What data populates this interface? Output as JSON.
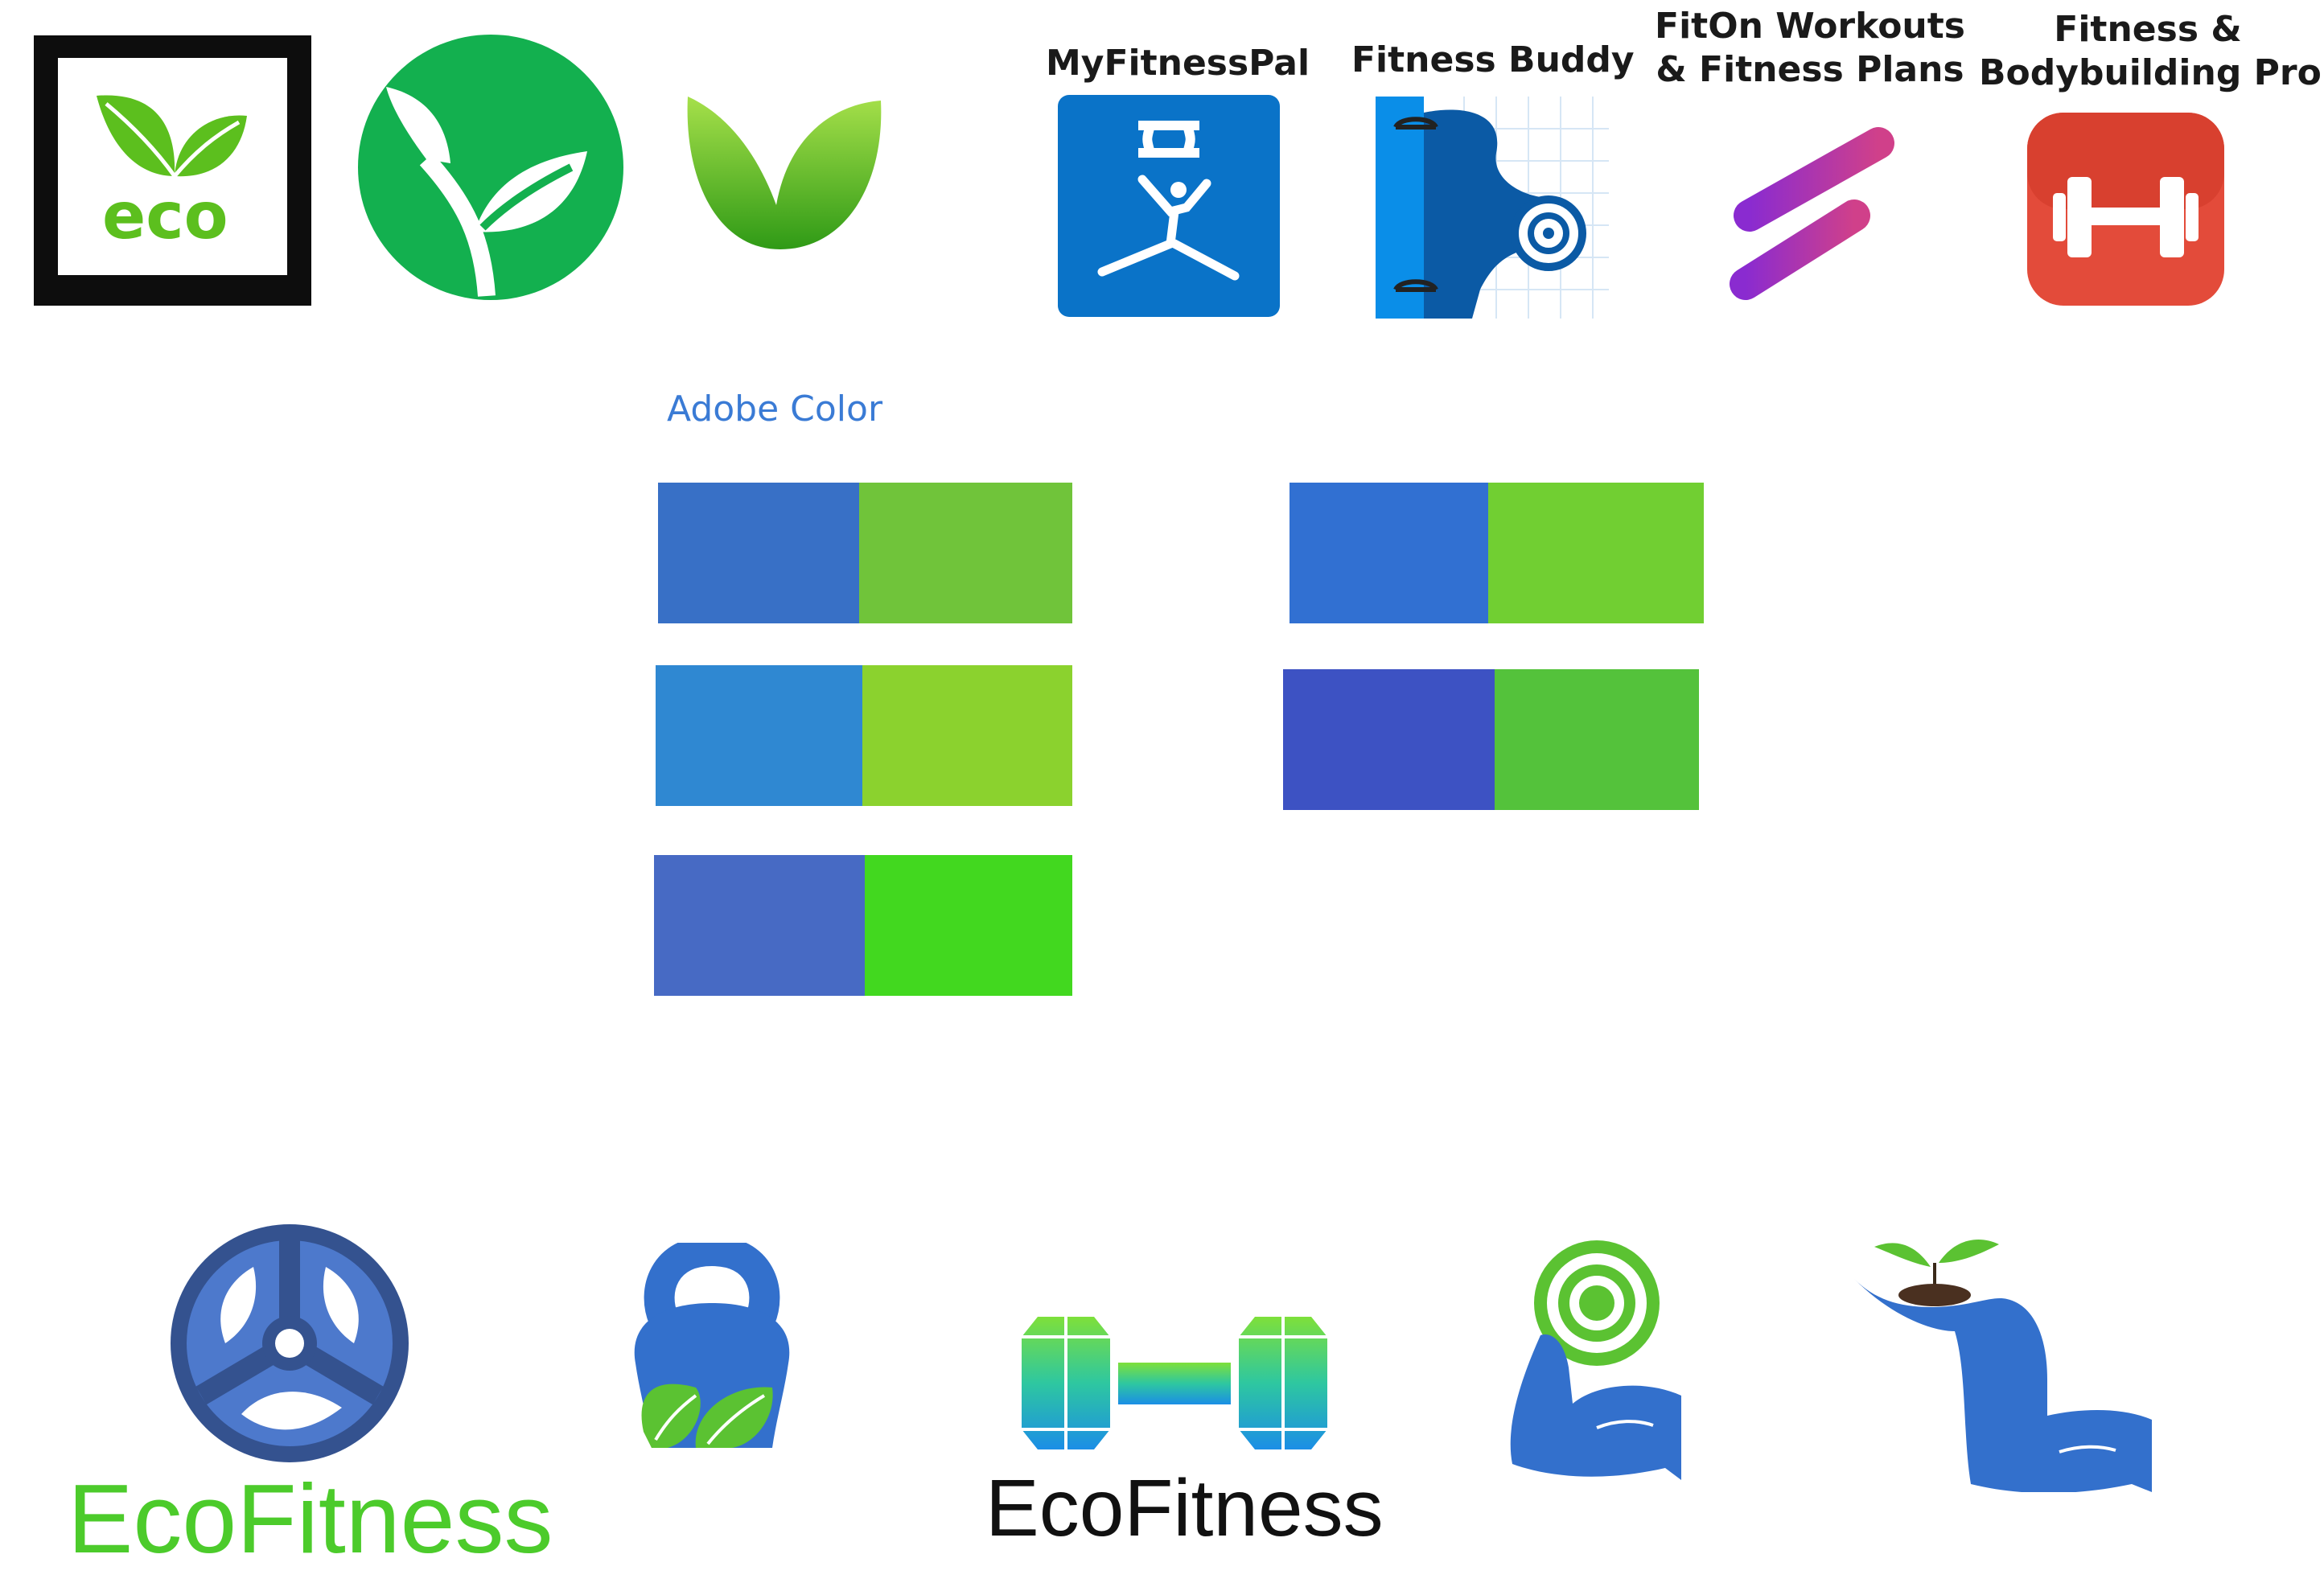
{
  "app_icons": [
    {
      "name": "MyFitnessPal"
    },
    {
      "name": "Fitness Buddy"
    },
    {
      "name_lines": [
        "FitOn Workouts",
        "& Fitness Plans"
      ]
    },
    {
      "name_lines": [
        "Fitness &",
        "Bodybuilding Pro"
      ]
    }
  ],
  "eco_logo_text": "eco",
  "palette_source": "Adobe Color",
  "palettes": [
    {
      "blue": "#3870C6",
      "green": "#70C43A"
    },
    {
      "blue": "#3170D2",
      "green": "#71CF32"
    },
    {
      "blue": "#2F88D2",
      "green": "#8BD22E"
    },
    {
      "blue": "#3D52C3",
      "green": "#54C23B"
    },
    {
      "blue": "#476AC4",
      "green": "#42D81F"
    }
  ],
  "brand": {
    "name_green": "EcoFitness",
    "name_black": "EcoFitness",
    "green_color": "#4CCB2B",
    "blue_color": "#3370CC"
  },
  "icons": [
    "eco-badge-icon",
    "sprout-circle-icon",
    "leaf-icon",
    "myfitnesspal-app-icon",
    "fitness-buddy-app-icon",
    "fiton-app-icon",
    "fitness-bodybuilding-app-icon",
    "weight-plate-leaf-icon",
    "kettlebell-leaf-icon",
    "gradient-dumbbell-icon",
    "flexed-arm-target-icon",
    "hand-sprout-arm-icon"
  ]
}
